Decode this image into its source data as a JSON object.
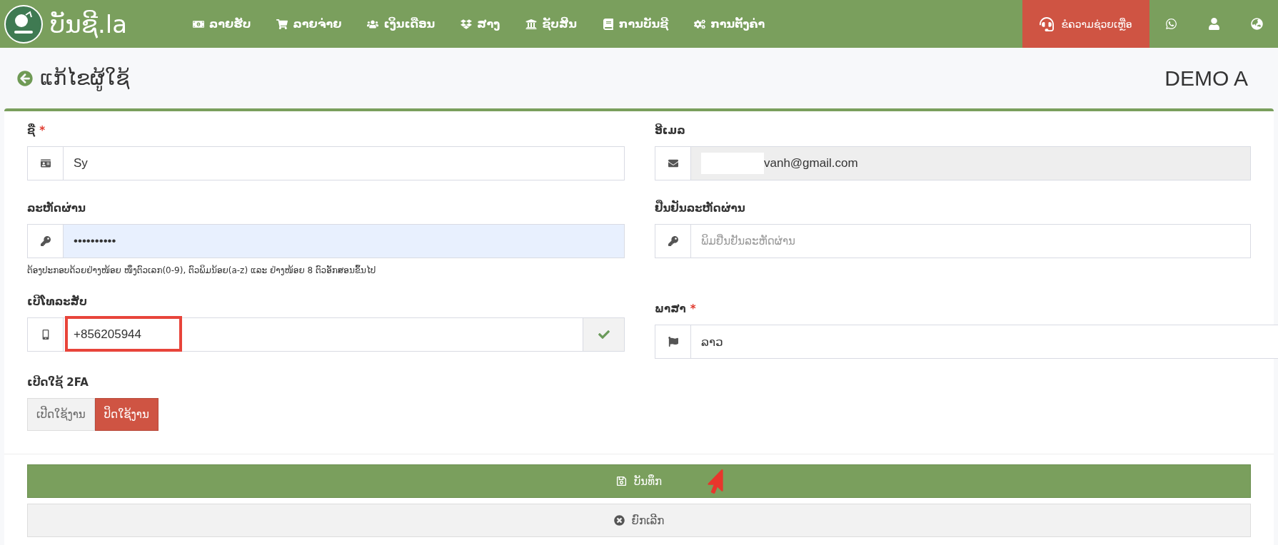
{
  "nav": {
    "brand": "ບັນຊີ.la",
    "items": [
      {
        "label": "ລາຍຮັບ"
      },
      {
        "label": "ລາຍຈ່າຍ"
      },
      {
        "label": "ເງິນເດືອນ"
      },
      {
        "label": "ສາງ"
      },
      {
        "label": "ຊັບສິນ"
      },
      {
        "label": "ການບັນຊີ"
      },
      {
        "label": "ການຕັ້ງຄ່າ"
      }
    ],
    "help": "ຂໍຄວາມຊ່ວຍເຫຼືອ"
  },
  "header": {
    "title": "ແກ້ໄຂຜູ້ໃຊ້",
    "company": "DEMO A"
  },
  "form": {
    "name": {
      "label": "ຊື່",
      "required_mark": "*",
      "value": "Sy"
    },
    "email": {
      "label": "ອີເມລ",
      "disabled": true,
      "redacted": true,
      "value": "vanh@gmail.com"
    },
    "password": {
      "label": "ລະຫັດຜ່ານ",
      "autofilled": true,
      "value": "••••••••••",
      "hint": "ຕ້ອງປະກອບດ້ວຍຢ່າງໜ້ອຍ ໜຶ່ງຕົວເລກ(0-9), ຕົວພິມນ້ອຍ(a-z) ແລະ ຢ່າງໜ້ອຍ 8 ຕົວອັກສອນຂຶ້ນໄປ"
    },
    "confirm_password": {
      "label": "ຢືນຢັນລະຫັດຜ່ານ",
      "placeholder": "ພິມຢືນຢັນລະຫັດຜ່ານ"
    },
    "phone": {
      "label": "ເບີໂທລະສັບ",
      "value": "+856205944",
      "verified": true,
      "highlighted": true
    },
    "language": {
      "label": "ພາສາ",
      "required_mark": "*",
      "value": "ລາວ"
    },
    "twofa": {
      "label": "ເປີດໃຊ້ 2FA",
      "options": [
        {
          "label": "ເປີດໃຊ້ງານ",
          "selected": false
        },
        {
          "label": "ປິດໃຊ້ງານ",
          "selected": true
        }
      ]
    }
  },
  "actions": {
    "save": {
      "label": "ບັນທຶກ",
      "pointer": true
    },
    "cancel": {
      "label": "ຍົກເລີກ"
    }
  }
}
